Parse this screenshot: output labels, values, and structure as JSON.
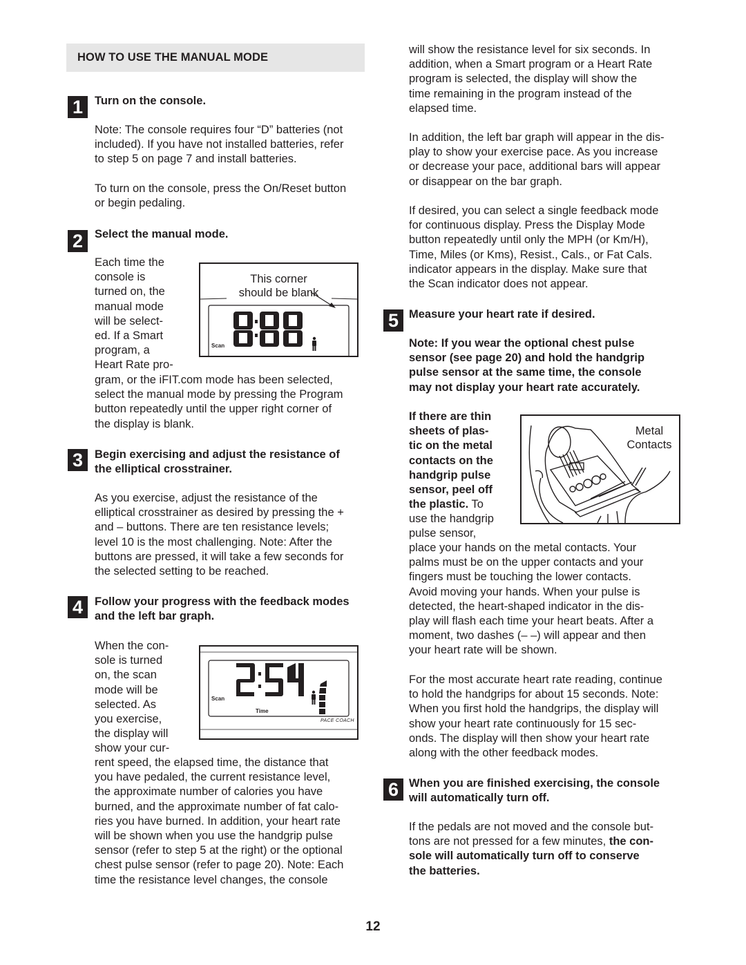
{
  "section": {
    "title": "HOW TO USE THE MANUAL MODE"
  },
  "steps": [
    {
      "number": "1",
      "title": "Turn on the console.",
      "paragraphs": [
        "Note: The console requires four “D” batteries (not\nincluded). If you have not installed batteries, refer\nto step 5 on page 7 and install batteries.",
        "To turn on the console, press the On/Reset button\nor begin pedaling."
      ]
    },
    {
      "number": "2",
      "title": "Select the manual mode.",
      "wrap_text": "Each time the\nconsole is\nturned on, the\nmanual mode\nwill be select-\ned. If a Smart\nprogram, a\nHeart Rate pro-",
      "continued_text": "gram, or the iFIT.com mode has been selected,\nselect the manual mode by pressing the Program\nbutton repeatedly until the upper right corner of\nthe display is blank.",
      "figure": {
        "caption": "This corner\nshould be blank",
        "display_value": "0:00",
        "scan_label": "Scan"
      }
    },
    {
      "number": "3",
      "title": "Begin exercising and adjust the resistance of\nthe elliptical crosstrainer.",
      "paragraphs": [
        "As you exercise, adjust the resistance of the\nelliptical crosstrainer as desired by pressing the +\nand – buttons. There are ten resistance levels;\nlevel 10 is the most challenging. Note: After the\nbuttons are pressed, it will take a few seconds for\nthe selected setting to be reached."
      ]
    },
    {
      "number": "4",
      "title": "Follow your progress with the feedback modes\nand the left bar graph.",
      "wrap_text": "When the con-\nsole is turned\non, the scan\nmode will be\nselected. As\nyou exercise,\nthe display will\nshow your cur-",
      "continued_text": "rent speed, the elapsed time, the distance that\nyou have pedaled, the current resistance level,\nthe approximate number of calories you have\nburned, and the approximate number of fat calo-\nries you have burned. In addition, your heart rate\nwill be shown when you use the handgrip pulse\nsensor (refer to step 5 at the right) or the optional\nchest pulse sensor (refer to page 20). Note: Each\ntime the resistance level changes, the console",
      "right_paragraphs": [
        "will show the resistance level for six seconds. In\naddition, when a Smart program or a Heart Rate\nprogram is selected, the display will show the\ntime remaining in the program instead of the\nelapsed time.",
        "In addition, the left bar graph will appear in the dis-\nplay to show your exercise pace. As you increase\nor decrease your pace, additional bars will appear\nor disappear on the bar graph.",
        "If desired, you can select a single feedback mode\nfor continuous display. Press the Display Mode\nbutton repeatedly until only the MPH (or Km/H),\nTime, Miles (or Kms), Resist., Cals., or Fat Cals.\nindicator appears in the display. Make sure that\nthe Scan indicator does not appear."
      ],
      "figure": {
        "display_value": "2:54",
        "scan_label": "Scan",
        "time_label": "Time",
        "pace_label": "PACE COACH"
      }
    },
    {
      "number": "5",
      "title": "Measure your heart rate if desired.",
      "note": "Note: If you wear the optional chest pulse\nsensor (see page 20) and hold the handgrip\npulse sensor at the same time, the console\nmay not display your heart rate accurately.",
      "wrap_bold": "If there are thin\nsheets of plas-\ntic on the metal\ncontacts on the\nhandgrip pulse\nsensor, peel off\nthe plastic.",
      "wrap_regular_inline": " To",
      "wrap_regular": "use the handgrip\npulse sensor,",
      "continued_text": "place your hands on the metal contacts. Your\npalms must be on the upper contacts and your\nfingers must be touching the lower contacts.\nAvoid moving your hands. When your pulse is\ndetected, the heart-shaped indicator in the dis-\nplay will flash each time your heart beats. After a\nmoment, two dashes (– –) will appear and then\nyour heart rate will be shown.",
      "paragraph2": "For the most accurate heart rate reading, continue\nto hold the handgrips for about 15 seconds. Note:\nWhen you first hold the handgrips, the display will\nshow your heart rate continuously for 15 sec-\nonds. The display will then show your heart rate\nalong with the other feedback modes.",
      "figure": {
        "caption": "Metal\nContacts"
      }
    },
    {
      "number": "6",
      "title": "When you are finished exercising, the console\nwill automatically turn off.",
      "text_regular": "If the pedals are not moved and the console but-\ntons are not pressed for a few minutes, ",
      "text_bold": "the con-\nsole will automatically turn off to conserve\nthe batteries."
    }
  ],
  "page_number": "12"
}
